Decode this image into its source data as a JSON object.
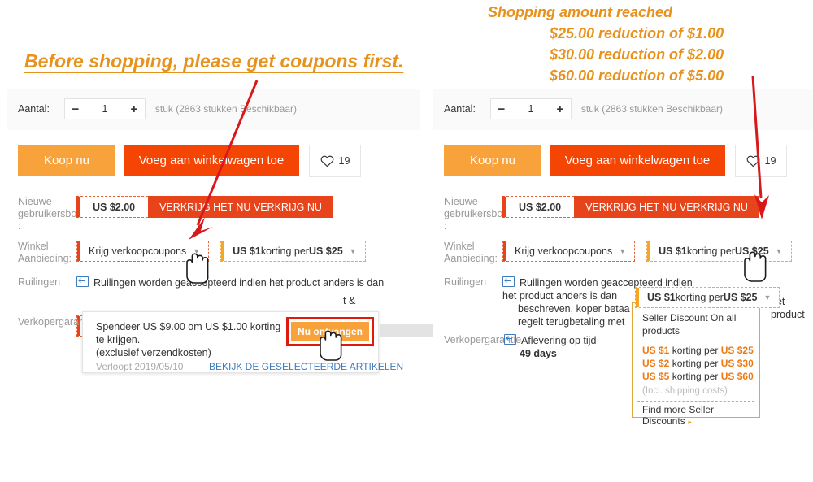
{
  "annotations": {
    "left_heading": "Before shopping, please get coupons first.",
    "right_heading_lines": [
      "Shopping amount reached",
      "$25.00 reduction of $1.00",
      "$30.00 reduction of $2.00",
      "$60.00 reduction of $5.00"
    ],
    "color": "#E8921E",
    "arrow_color": "#D7191C"
  },
  "product": {
    "qty_label": "Aantal:",
    "qty_minus": "−",
    "qty_value": "1",
    "qty_plus": "+",
    "qty_availability": "stuk (2863 stukken Beschikbaar)",
    "buy_now": "Koop nu",
    "add_to_cart": "Voeg aan winkelwagen toe",
    "favorite_count": "19",
    "favorite_icon": "heart-icon"
  },
  "rows": {
    "newuser_label": "Nieuwe gebruikersbon :",
    "newuser_amount": "US $2.00",
    "newuser_action": "VERKRIJG HET NU VERKRIJG NU",
    "store_offer_label": "Winkel Aanbieding:",
    "get_coupons_chip": "Krijg verkoopcoupons",
    "discount_chip_pre": "US $1",
    "discount_chip_mid": " korting per ",
    "discount_chip_post": "US $25",
    "exchange_label": "Ruilingen",
    "exchange_icon": "exchange-box-icon",
    "exchange_text_left": "Ruilingen worden geaccepteerd indien het product anders is dan",
    "exchange_text_left_tail": "t &",
    "exchange_text_right_line1": "Ruilingen worden geaccepteerd indien het product anders is dan",
    "exchange_text_right_line2": "beschreven, koper betaa",
    "exchange_text_right_line2_tail": "het product",
    "exchange_text_right_line3": "regelt terugbetaling met",
    "guarantee_label_left": "Verkopergaran",
    "guarantee_label_right": "Verkopergarantie",
    "guarantee_icon": "delivery-icon",
    "guarantee_text": "Aflevering op tijd",
    "guarantee_days": "49 days"
  },
  "left_popup": {
    "text": "Spendeer US $9.00 om US $1.00 korting te krijgen.",
    "note": "(exclusief verzendkosten)",
    "expires": "Verloopt 2019/05/10",
    "link": "BEKIJK DE GESELECTEERDE ARTIKELEN",
    "button": "Nu ontvangen",
    "cursor_icon": "hand-pointer-icon"
  },
  "right_popup": {
    "chip_pre": "US $1",
    "chip_mid": " korting per ",
    "chip_post": "US $25",
    "heading": "Seller Discount On all products",
    "tiers": [
      {
        "amount": "US $1",
        "mid": " korting per ",
        "threshold": "US $25"
      },
      {
        "amount": "US $2",
        "mid": " korting per ",
        "threshold": "US $30"
      },
      {
        "amount": "US $5",
        "mid": " korting per ",
        "threshold": "US $60"
      }
    ],
    "shipping_note": "(Incl. shipping costs)",
    "more_link": "Find more Seller Discounts",
    "more_arrow": "▸",
    "cursor_icon": "hand-pointer-icon"
  },
  "colors": {
    "accent_orange": "#f7a23b",
    "cart_red": "#f44504",
    "coupon_red": "#e8441c",
    "amber": "#f5a623",
    "link_blue": "#3e7bbf",
    "annotation": "#E8921E"
  }
}
